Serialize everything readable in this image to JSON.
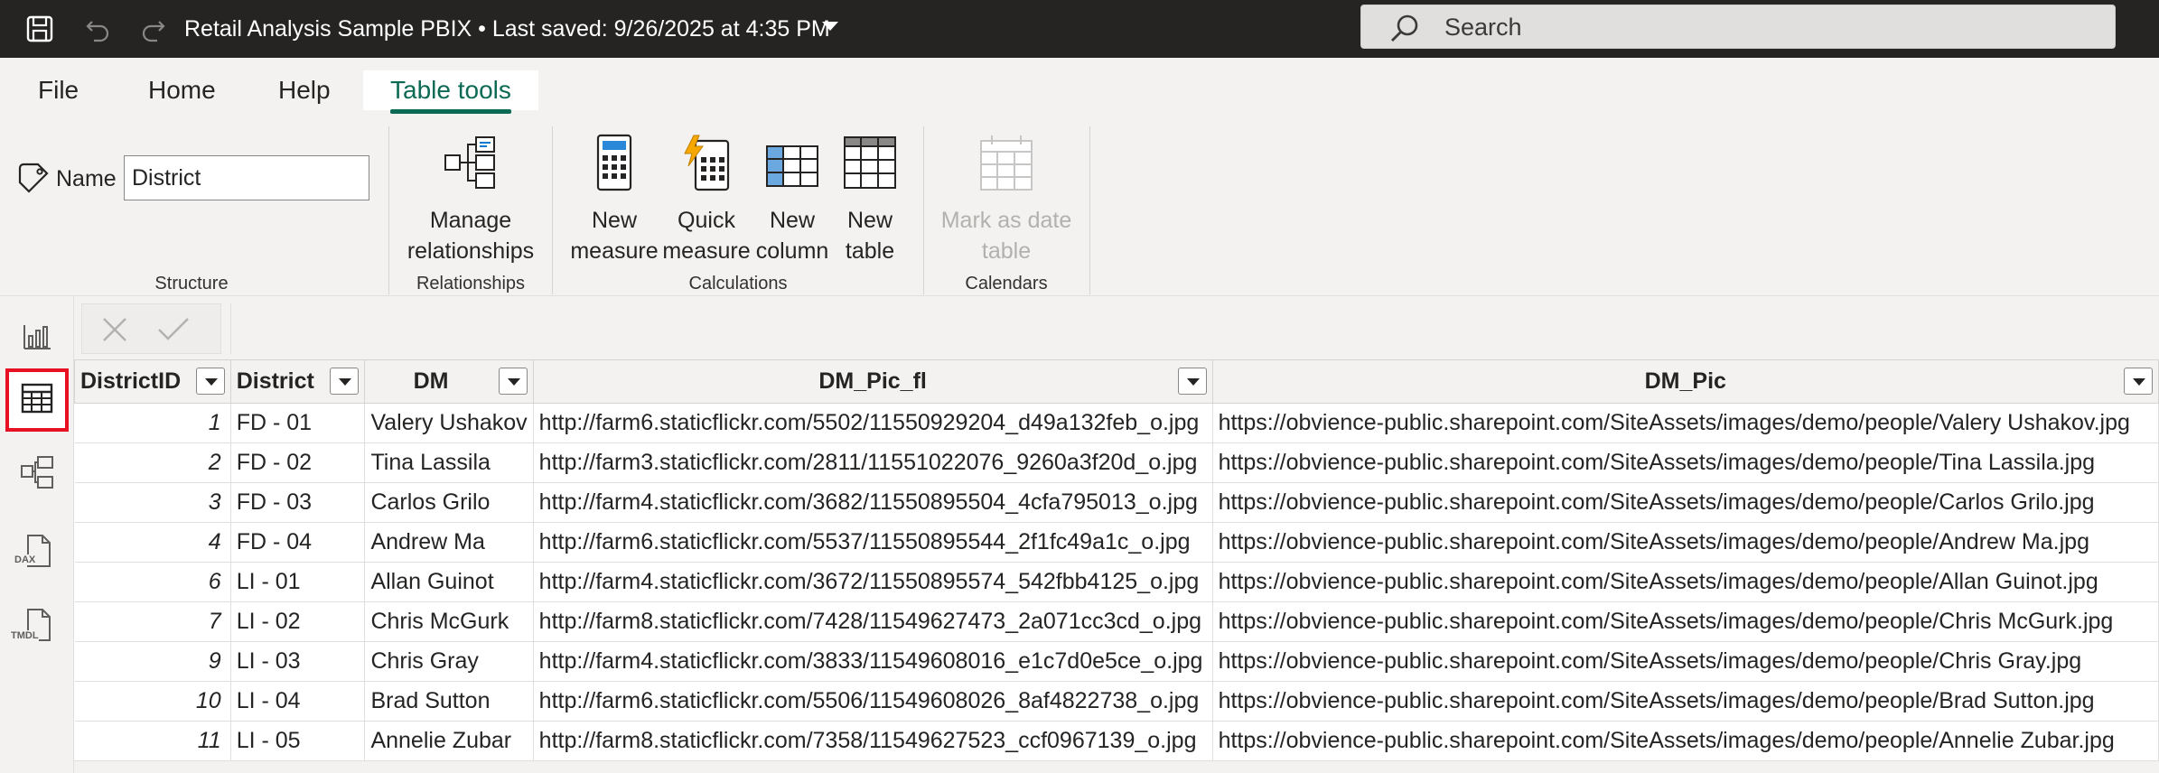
{
  "titlebar": {
    "title": "Retail Analysis Sample PBIX • Last saved: 9/26/2025 at 4:35 PM",
    "search_placeholder": "Search"
  },
  "menu": {
    "tabs": [
      "File",
      "Home",
      "Help",
      "Table tools"
    ],
    "active_tab": "Table tools",
    "accent_color": "#0b6a53"
  },
  "ribbon": {
    "structure": {
      "name_label": "Name",
      "name_value": "District",
      "group_label": "Structure"
    },
    "relationships": {
      "manage_line1": "Manage",
      "manage_line2": "relationships",
      "group_label": "Relationships"
    },
    "calculations": {
      "new_measure_line1": "New",
      "new_measure_line2": "measure",
      "quick_measure_line1": "Quick",
      "quick_measure_line2": "measure",
      "new_column_line1": "New",
      "new_column_line2": "column",
      "new_table_line1": "New",
      "new_table_line2": "table",
      "group_label": "Calculations"
    },
    "calendars": {
      "mark_line1": "Mark as date",
      "mark_line2": "table",
      "group_label": "Calendars"
    }
  },
  "rail": {
    "items": [
      "report-view-icon",
      "table-view-icon",
      "model-view-icon",
      "dax-query-view-icon",
      "tmdl-view-icon"
    ],
    "selected": "table-view-icon",
    "dax_label": "DAX",
    "tmdl_label": "TMDL"
  },
  "table": {
    "columns": [
      "DistrictID",
      "District",
      "DM",
      "DM_Pic_fl",
      "DM_Pic"
    ],
    "rows": [
      [
        "1",
        "FD - 01",
        "Valery Ushakov",
        "http://farm6.staticflickr.com/5502/11550929204_d49a132feb_o.jpg",
        "https://obvience-public.sharepoint.com/SiteAssets/images/demo/people/Valery Ushakov.jpg"
      ],
      [
        "2",
        "FD - 02",
        "Tina Lassila",
        "http://farm3.staticflickr.com/2811/11551022076_9260a3f20d_o.jpg",
        "https://obvience-public.sharepoint.com/SiteAssets/images/demo/people/Tina Lassila.jpg"
      ],
      [
        "3",
        "FD - 03",
        "Carlos Grilo",
        "http://farm4.staticflickr.com/3682/11550895504_4cfa795013_o.jpg",
        "https://obvience-public.sharepoint.com/SiteAssets/images/demo/people/Carlos Grilo.jpg"
      ],
      [
        "4",
        "FD - 04",
        "Andrew Ma",
        "http://farm6.staticflickr.com/5537/11550895544_2f1fc49a1c_o.jpg",
        "https://obvience-public.sharepoint.com/SiteAssets/images/demo/people/Andrew Ma.jpg"
      ],
      [
        "6",
        "LI - 01",
        "Allan Guinot",
        "http://farm4.staticflickr.com/3672/11550895574_542fbb4125_o.jpg",
        "https://obvience-public.sharepoint.com/SiteAssets/images/demo/people/Allan Guinot.jpg"
      ],
      [
        "7",
        "LI - 02",
        "Chris McGurk",
        "http://farm8.staticflickr.com/7428/11549627473_2a071cc3cd_o.jpg",
        "https://obvience-public.sharepoint.com/SiteAssets/images/demo/people/Chris McGurk.jpg"
      ],
      [
        "9",
        "LI - 03",
        "Chris Gray",
        "http://farm4.staticflickr.com/3833/11549608016_e1c7d0e5ce_o.jpg",
        "https://obvience-public.sharepoint.com/SiteAssets/images/demo/people/Chris Gray.jpg"
      ],
      [
        "10",
        "LI - 04",
        "Brad Sutton",
        "http://farm6.staticflickr.com/5506/11549608026_8af4822738_o.jpg",
        "https://obvience-public.sharepoint.com/SiteAssets/images/demo/people/Brad Sutton.jpg"
      ],
      [
        "11",
        "LI - 05",
        "Annelie Zubar",
        "http://farm8.staticflickr.com/7358/11549627523_ccf0967139_o.jpg",
        "https://obvience-public.sharepoint.com/SiteAssets/images/demo/people/Annelie Zubar.jpg"
      ]
    ]
  }
}
